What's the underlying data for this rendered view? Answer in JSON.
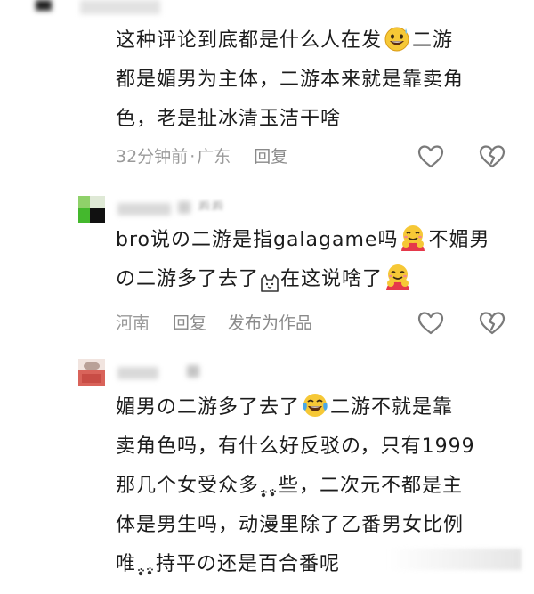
{
  "comments": [
    {
      "lines": [
        "这种评论到底都是什么人在发",
        "二游",
        "都是媚男为主体，二游本来就是靠卖角",
        "色，老是扯冰清玉洁干啥"
      ],
      "time": "32分钟前",
      "sep": "·",
      "location": "广东",
      "reply_label": "回复",
      "emoji_1": "grinning-sweat-emoji"
    },
    {
      "lines": [
        "bro说の二游是指galagame吗",
        "不媚男",
        "の二游多了去了",
        "在这说啥了"
      ],
      "location": "河南",
      "reply_label": "回复",
      "publish_label": "发布为作品",
      "username_partial": "看看"
    },
    {
      "lines": [
        "媚男の二游多了去了",
        "二游不就是靠",
        "卖角色吗，有什么好反驳の，只有1999",
        "那几个女受众多",
        "些，二次元不都是主",
        "体是男生吗，动漫里除了乙番男女比例",
        "唯",
        "持平の还是百合番呢"
      ]
    }
  ],
  "icons": {
    "like": "heart-outline-icon",
    "dislike": "broken-heart-icon",
    "hug": "hugging-face-emoji",
    "cat": "cat-face-emoji",
    "laugh": "crying-laughing-emoji",
    "paw": "paw-prints-emoji"
  }
}
